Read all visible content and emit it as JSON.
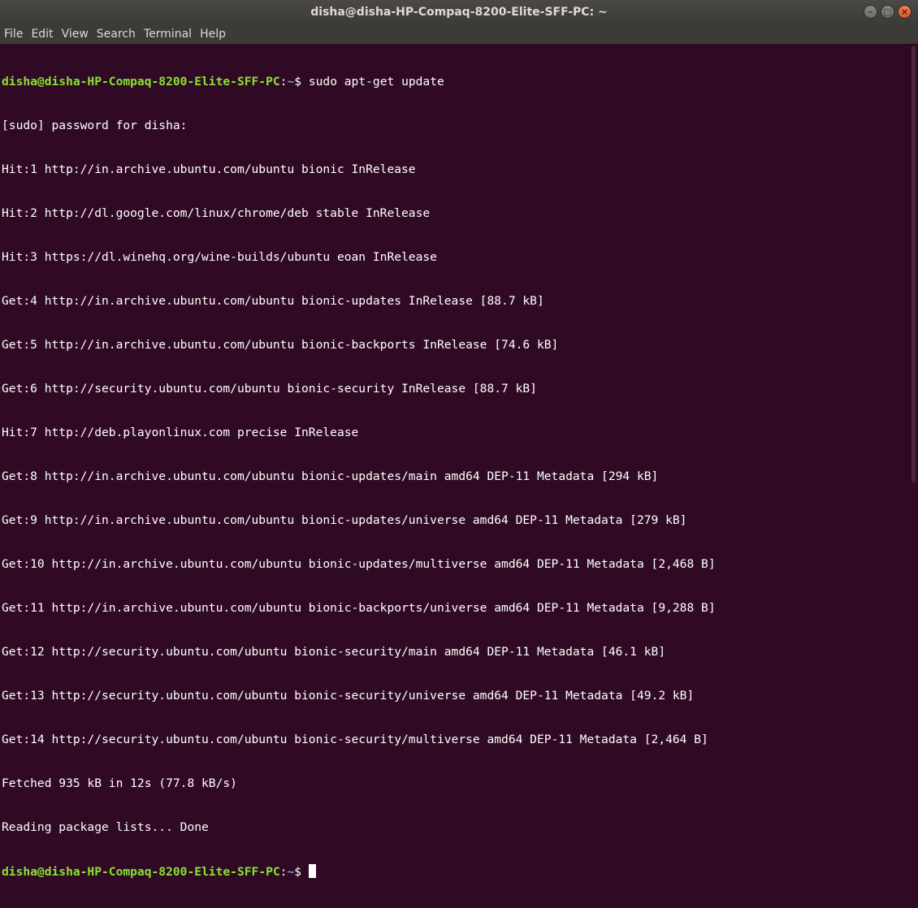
{
  "window": {
    "title": "disha@disha-HP-Compaq-8200-Elite-SFF-PC: ~",
    "buttons": {
      "minimize": "–",
      "maximize": "□",
      "close": "×"
    }
  },
  "menu": [
    "File",
    "Edit",
    "View",
    "Search",
    "Terminal",
    "Help"
  ],
  "terminal": {
    "prompt_user": "disha@disha-HP-Compaq-8200-Elite-SFF-PC",
    "prompt_path": "~",
    "prompt_suffix": "$ ",
    "command": "sudo apt-get update",
    "output": [
      "[sudo] password for disha:",
      "Hit:1 http://in.archive.ubuntu.com/ubuntu bionic InRelease",
      "Hit:2 http://dl.google.com/linux/chrome/deb stable InRelease",
      "Hit:3 https://dl.winehq.org/wine-builds/ubuntu eoan InRelease",
      "Get:4 http://in.archive.ubuntu.com/ubuntu bionic-updates InRelease [88.7 kB]",
      "Get:5 http://in.archive.ubuntu.com/ubuntu bionic-backports InRelease [74.6 kB]",
      "Get:6 http://security.ubuntu.com/ubuntu bionic-security InRelease [88.7 kB]",
      "Hit:7 http://deb.playonlinux.com precise InRelease",
      "Get:8 http://in.archive.ubuntu.com/ubuntu bionic-updates/main amd64 DEP-11 Metadata [294 kB]",
      "Get:9 http://in.archive.ubuntu.com/ubuntu bionic-updates/universe amd64 DEP-11 Metadata [279 kB]",
      "Get:10 http://in.archive.ubuntu.com/ubuntu bionic-updates/multiverse amd64 DEP-11 Metadata [2,468 B]",
      "Get:11 http://in.archive.ubuntu.com/ubuntu bionic-backports/universe amd64 DEP-11 Metadata [9,288 B]",
      "Get:12 http://security.ubuntu.com/ubuntu bionic-security/main amd64 DEP-11 Metadata [46.1 kB]",
      "Get:13 http://security.ubuntu.com/ubuntu bionic-security/universe amd64 DEP-11 Metadata [49.2 kB]",
      "Get:14 http://security.ubuntu.com/ubuntu bionic-security/multiverse amd64 DEP-11 Metadata [2,464 B]",
      "Fetched 935 kB in 12s (77.8 kB/s)",
      "Reading package lists... Done"
    ]
  },
  "colors": {
    "background": "#300a24",
    "prompt_user": "#8ae234",
    "prompt_path": "#729fcf",
    "text": "#ffffff",
    "titlebar": "#3c3b37",
    "close_button": "#e95420"
  }
}
